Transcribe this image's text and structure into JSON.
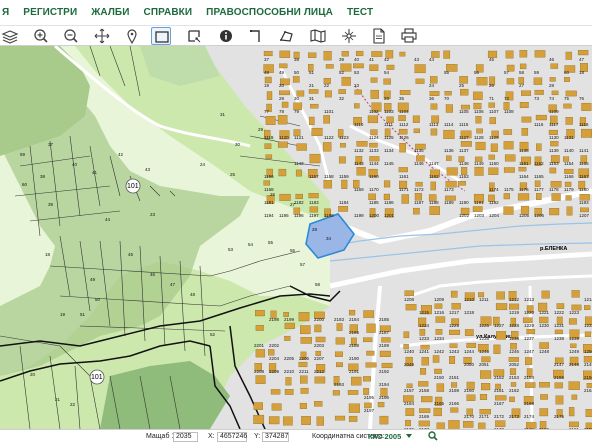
{
  "menu": {
    "items": [
      {
        "label": "Я"
      },
      {
        "label": "РЕГИСТРИ"
      },
      {
        "label": "ЖАЛБИ"
      },
      {
        "label": "СПРАВКИ"
      },
      {
        "label": "ПРАВОСПОСОБНИ ЛИЦА"
      },
      {
        "label": "ТЕСТ"
      }
    ]
  },
  "toolbar": {
    "tools": [
      {
        "icon": "layers-icon"
      },
      {
        "icon": "zoom-in-icon"
      },
      {
        "icon": "zoom-out-icon"
      },
      {
        "icon": "pan-icon"
      },
      {
        "icon": "location-pin-icon"
      },
      {
        "icon": "select-rectangle-icon",
        "active": true
      },
      {
        "icon": "select-polygon-icon"
      },
      {
        "icon": "info-icon"
      },
      {
        "icon": "measure-distance-icon"
      },
      {
        "icon": "measure-area-icon"
      },
      {
        "icon": "map-icon"
      },
      {
        "icon": "coordinates-icon"
      },
      {
        "icon": "document-icon"
      },
      {
        "icon": "print-icon"
      }
    ]
  },
  "map": {
    "colors": {
      "forest": "#a8cb8c",
      "forest_dark": "#8fbc7a",
      "meadow": "#cde8ad",
      "field": "#e9f5d9",
      "urban": "#e2e2e2",
      "road": "#ffffff",
      "building": "#d5a03a",
      "selected_parcel": "#9ab6e6",
      "selected_border": "#2a8ad8"
    },
    "selected_parcel_label": "34",
    "road_markers": [
      "101",
      "101"
    ],
    "street_labels": [
      "р.ЕЛЕНКА",
      "ул.Калугерица"
    ],
    "parcel_labels": [
      "37",
      "38",
      "39",
      "40",
      "41",
      "42",
      "43",
      "44",
      "45",
      "46",
      "47",
      "48",
      "49",
      "50",
      "51",
      "52",
      "53",
      "54",
      "55",
      "56",
      "57",
      "58",
      "59",
      "60",
      "18",
      "19",
      "20",
      "21",
      "22",
      "23",
      "24",
      "25",
      "26",
      "27",
      "28",
      "29",
      "30",
      "31",
      "32",
      "33",
      "35",
      "36",
      "70",
      "71",
      "72",
      "73",
      "74",
      "75",
      "76",
      "77",
      "78",
      "79",
      "1101",
      "1102",
      "1103",
      "1104",
      "1105",
      "1106",
      "1107",
      "1108",
      "1109",
      "1110",
      "1111",
      "1112",
      "1113",
      "1114",
      "1115",
      "1116",
      "1117",
      "1118",
      "1119",
      "1120",
      "1121",
      "1122",
      "1123",
      "1124",
      "1125",
      "1126",
      "1127",
      "1128",
      "1129",
      "1130",
      "1131",
      "1132",
      "1133",
      "1134",
      "1135",
      "1136",
      "1137",
      "1138",
      "1139",
      "1140",
      "1141",
      "1142",
      "1143",
      "1144",
      "1145",
      "1146",
      "1147",
      "1148",
      "1149",
      "1150",
      "1151",
      "1152",
      "1153",
      "1154",
      "1155",
      "1156",
      "1157",
      "1158",
      "1159",
      "1160",
      "1161",
      "1162",
      "1163",
      "1164",
      "1165",
      "1166",
      "1167",
      "1168",
      "1169",
      "1170",
      "1171",
      "1172",
      "1173",
      "1174",
      "1175",
      "1176",
      "1177",
      "1178",
      "1179",
      "1180",
      "1181",
      "1182",
      "1183",
      "1184",
      "1185",
      "1186",
      "1187",
      "1188",
      "1189",
      "1190",
      "1191",
      "1192",
      "1193",
      "1194",
      "1195",
      "1196",
      "1197",
      "1198",
      "1199",
      "1200",
      "1201",
      "1202",
      "1203",
      "1204",
      "1205",
      "1206",
      "1207",
      "1208",
      "1209",
      "1210",
      "1211",
      "1212",
      "1213",
      "1214",
      "1215",
      "1216",
      "1217",
      "1218",
      "1219",
      "1220",
      "1221",
      "1222",
      "1223",
      "1224",
      "1225",
      "1226",
      "1227",
      "1228",
      "1229",
      "1230",
      "1231",
      "1232",
      "1233",
      "1234",
      "1235",
      "1236",
      "1237",
      "1238",
      "1239",
      "1240",
      "1241",
      "1242",
      "1243",
      "1244",
      "1245",
      "1246",
      "1247",
      "1248",
      "1249",
      "1250",
      "2049",
      "2050",
      "2051",
      "2052",
      "2147",
      "2148",
      "2149",
      "2150",
      "2151",
      "2152",
      "2153",
      "2154",
      "2155",
      "2156",
      "2157",
      "2158",
      "2159",
      "2160",
      "2161",
      "2162",
      "2163",
      "2164",
      "2165",
      "2166",
      "2167",
      "2168",
      "2169",
      "2170",
      "2171",
      "2172",
      "2173",
      "2174",
      "2175",
      "2176",
      "2177",
      "2178",
      "2179",
      "2180",
      "2181",
      "2182",
      "2183",
      "2184",
      "2185",
      "2186",
      "2187",
      "2188",
      "2189",
      "2190",
      "2191",
      "2192",
      "2193",
      "2194",
      "2195",
      "2196",
      "2197",
      "2198",
      "2199",
      "2200",
      "2201",
      "2202",
      "2203",
      "2204",
      "2205",
      "2206",
      "2207",
      "2208",
      "2209",
      "2210",
      "2211",
      "2212"
    ]
  },
  "status": {
    "scale_label": "Мащаб 1:",
    "scale_value": "2035",
    "x_label": "X:",
    "x_value": "4657246",
    "y_label": "Y:",
    "y_value": "374287",
    "system_label": "Координатна система:",
    "system_value": "ККС 2005"
  }
}
